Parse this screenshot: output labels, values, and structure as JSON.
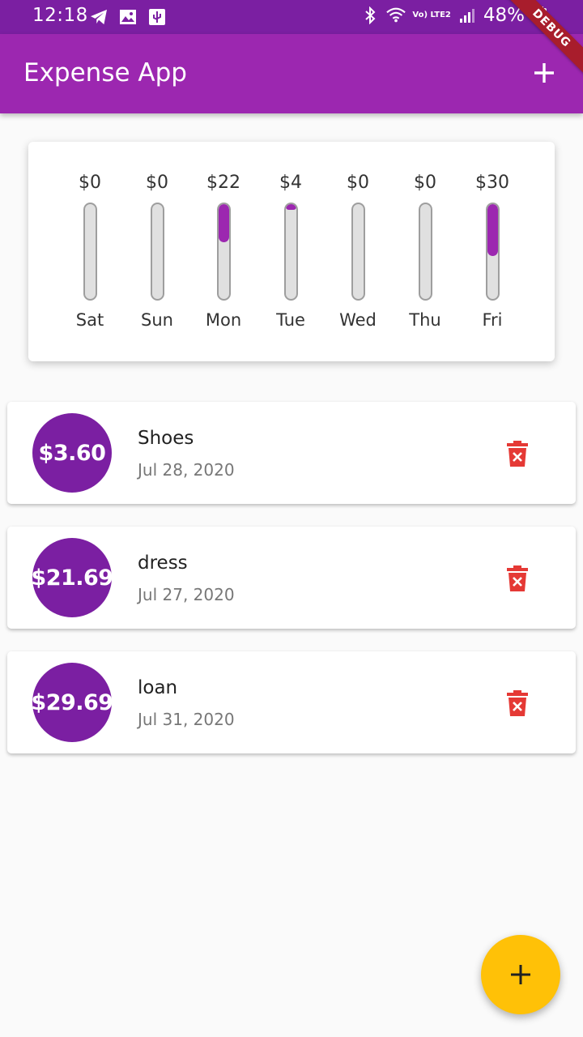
{
  "status_bar": {
    "time": "12:18",
    "battery": "48%",
    "network": "Vo) LTE2"
  },
  "debug_banner": "DEBUG",
  "app_bar": {
    "title": "Expense App",
    "add_icon": "plus-icon"
  },
  "chart": {
    "bars": [
      {
        "day": "Sat",
        "amount": "$0",
        "fraction": 0
      },
      {
        "day": "Sun",
        "amount": "$0",
        "fraction": 0
      },
      {
        "day": "Mon",
        "amount": "$22",
        "fraction": 0.4
      },
      {
        "day": "Tue",
        "amount": "$4",
        "fraction": 0.06
      },
      {
        "day": "Wed",
        "amount": "$0",
        "fraction": 0
      },
      {
        "day": "Thu",
        "amount": "$0",
        "fraction": 0
      },
      {
        "day": "Fri",
        "amount": "$30",
        "fraction": 0.55
      }
    ]
  },
  "transactions": [
    {
      "amount": "$3.60",
      "title": "Shoes",
      "date": "Jul 28, 2020"
    },
    {
      "amount": "$21.69",
      "title": "dress",
      "date": "Jul 27, 2020"
    },
    {
      "amount": "$29.69",
      "title": "loan",
      "date": "Jul 31, 2020"
    }
  ],
  "colors": {
    "primary": "#9c27b0",
    "primary_dark": "#7b1fa2",
    "accent": "#ffc107",
    "delete": "#e53935"
  }
}
